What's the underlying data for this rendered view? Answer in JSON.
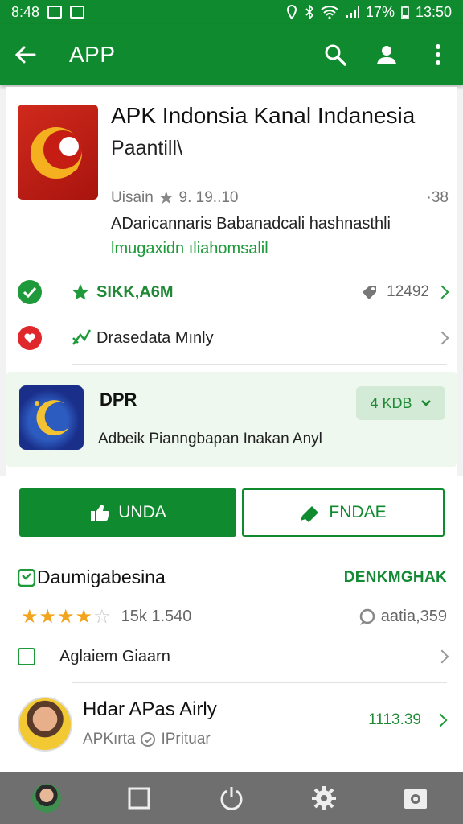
{
  "status_bar": {
    "time_left": "8:48",
    "battery": "17%",
    "time_right": "13:50"
  },
  "app_bar": {
    "title": "APP",
    "icons": [
      "back-arrow-icon",
      "search-icon",
      "account-icon",
      "more-vert-icon"
    ]
  },
  "app": {
    "title": "APK Indonsia Kanal Indanesia",
    "subtitle": "Paantill\\",
    "meta_left": "Uisain",
    "meta_rating": "9. 19..10",
    "meta_right": "·38",
    "description": "ADaricannaris Babanadcali hashnasthli",
    "link": "lmugaxidn ıliahomsalil"
  },
  "rows": {
    "verified_label": "SIKK,A6M",
    "verified_count": "12492",
    "data_label": "Drasedata Mınly"
  },
  "promo": {
    "title": "DPR",
    "subtitle": "Adbeik Pianngbapan Inakan Anyl",
    "chip": "4 KDB"
  },
  "buttons": {
    "primary": "UNDA",
    "secondary": "FNDAE"
  },
  "ratings": {
    "title": "Daumigabesina",
    "action": "DENKMGHAK",
    "stars_filled": 4,
    "stars_total": 5,
    "count": "15k 1.540",
    "right": "aatia,359",
    "checkbox_label": "Aglaiem Giaarn"
  },
  "developer": {
    "name": "Hdar APas Airly",
    "sub_left": "APKırta",
    "sub_right": "IPrituar",
    "value": "1113.39"
  },
  "colors": {
    "brand": "#0f8a2e",
    "accent_green": "#1f9a3a",
    "star": "#f2a41c"
  }
}
